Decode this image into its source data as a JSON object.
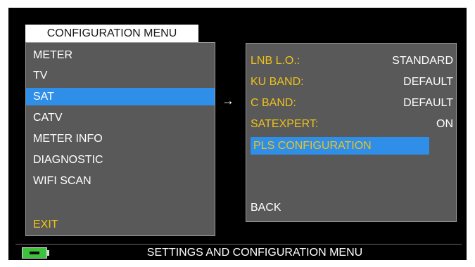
{
  "menu": {
    "title": "CONFIGURATION MENU",
    "items": [
      "METER",
      "TV",
      "SAT",
      "CATV",
      "METER INFO",
      "DIAGNOSTIC",
      "WIFI SCAN"
    ],
    "selected": "SAT",
    "exit_label": "EXIT"
  },
  "arrow": "→",
  "submenu": {
    "rows": [
      {
        "label": "LNB L.O.:",
        "value": "STANDARD"
      },
      {
        "label": "KU BAND:",
        "value": "DEFAULT"
      },
      {
        "label": "C BAND:",
        "value": "DEFAULT"
      },
      {
        "label": "SATEXPERT:",
        "value": "ON"
      }
    ],
    "selected_label": "PLS CONFIGURATION",
    "back_label": "BACK"
  },
  "status_bar": {
    "battery_icon": "battery-charging-icon",
    "text": "SETTINGS AND CONFIGURATION MENU"
  },
  "colors": {
    "highlight": "#2f8fe8",
    "label_yellow": "#f0c21a",
    "panel_gray": "#595959",
    "battery_green": "#3cc23c"
  }
}
